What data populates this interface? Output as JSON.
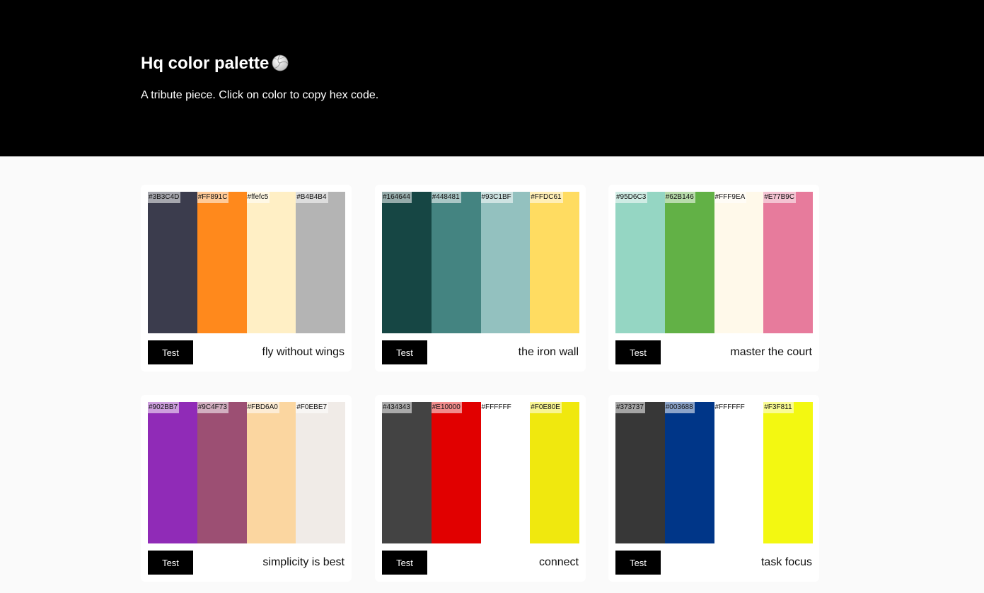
{
  "header": {
    "title": "Hq color palette",
    "subtitle": "A tribute piece. Click on color to copy hex code.",
    "title_icon": "volleyball-icon"
  },
  "palettes": [
    {
      "name": "fly without wings",
      "button_label": "Test",
      "colors": [
        {
          "hex": "#3B3C4D",
          "label": "#3B3C4D"
        },
        {
          "hex": "#FF891C",
          "label": "#FF891C"
        },
        {
          "hex": "#FFEFC5",
          "label": "#ffefc5"
        },
        {
          "hex": "#B4B4B4",
          "label": "#B4B4B4"
        }
      ]
    },
    {
      "name": "the iron wall",
      "button_label": "Test",
      "colors": [
        {
          "hex": "#164644",
          "label": "#164644"
        },
        {
          "hex": "#448481",
          "label": "#448481"
        },
        {
          "hex": "#93C1BF",
          "label": "#93C1BF"
        },
        {
          "hex": "#FFDC61",
          "label": "#FFDC61"
        }
      ]
    },
    {
      "name": "master the court",
      "button_label": "Test",
      "colors": [
        {
          "hex": "#95D6C3",
          "label": "#95D6C3"
        },
        {
          "hex": "#62B146",
          "label": "#62B146"
        },
        {
          "hex": "#FFF9EA",
          "label": "#FFF9EA"
        },
        {
          "hex": "#E77B9C",
          "label": "#E77B9C"
        }
      ]
    },
    {
      "name": "simplicity is best",
      "button_label": "Test",
      "colors": [
        {
          "hex": "#902BB7",
          "label": "#902BB7"
        },
        {
          "hex": "#9C4F73",
          "label": "#9C4F73"
        },
        {
          "hex": "#FBD6A0",
          "label": "#FBD6A0"
        },
        {
          "hex": "#F0EBE7",
          "label": "#F0EBE7"
        }
      ]
    },
    {
      "name": "connect",
      "button_label": "Test",
      "colors": [
        {
          "hex": "#434343",
          "label": "#434343"
        },
        {
          "hex": "#E10000",
          "label": "#E10000"
        },
        {
          "hex": "#FFFFFF",
          "label": "#FFFFFF"
        },
        {
          "hex": "#F0E80E",
          "label": "#F0E80E"
        }
      ]
    },
    {
      "name": "task focus",
      "button_label": "Test",
      "colors": [
        {
          "hex": "#373737",
          "label": "#373737"
        },
        {
          "hex": "#003688",
          "label": "#003688"
        },
        {
          "hex": "#FFFFFF",
          "label": "#FFFFFF"
        },
        {
          "hex": "#F3F811",
          "label": "#F3F811"
        }
      ]
    }
  ]
}
